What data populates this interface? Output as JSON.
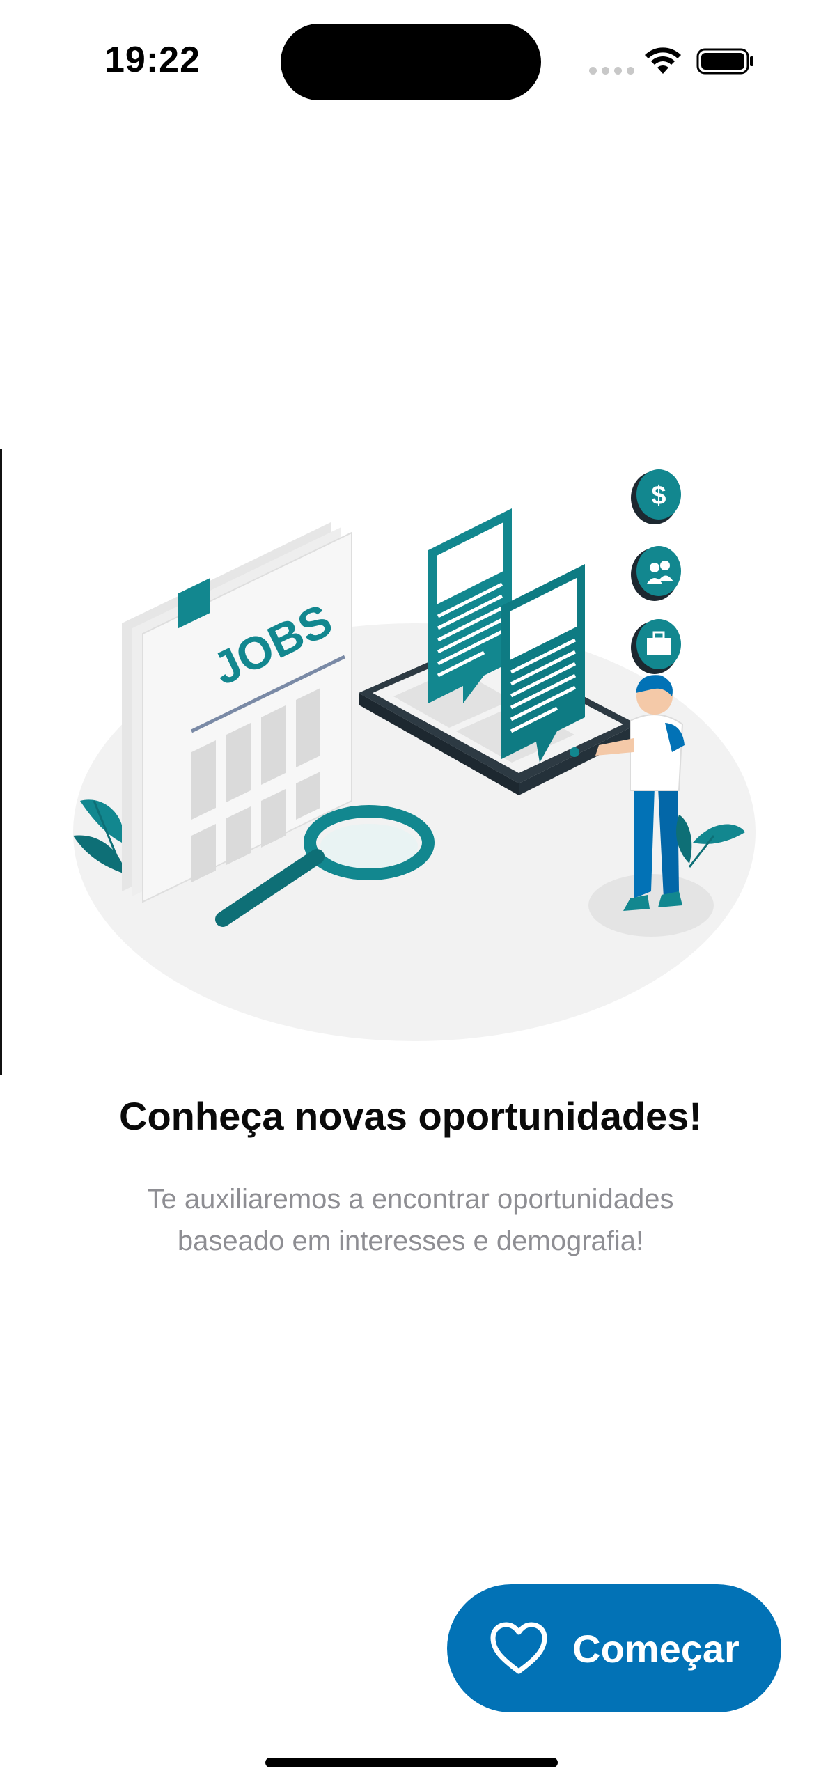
{
  "status_bar": {
    "time": "19:22"
  },
  "onboarding": {
    "illustration": {
      "newspaper_text": "JOBS",
      "coin_icons": [
        "dollar-icon",
        "people-icon",
        "briefcase-icon"
      ]
    },
    "title": "Conheça novas oportunidades!",
    "description_line1": "Te auxiliaremos a encontrar oportunidades",
    "description_line2": "baseado em interesses e demografia!",
    "start_button": {
      "label": "Começar",
      "icon": "heart-icon"
    }
  },
  "colors": {
    "accent": "#0272b6",
    "teal": "#12878f",
    "subtitle_gray": "#8e8e93"
  }
}
